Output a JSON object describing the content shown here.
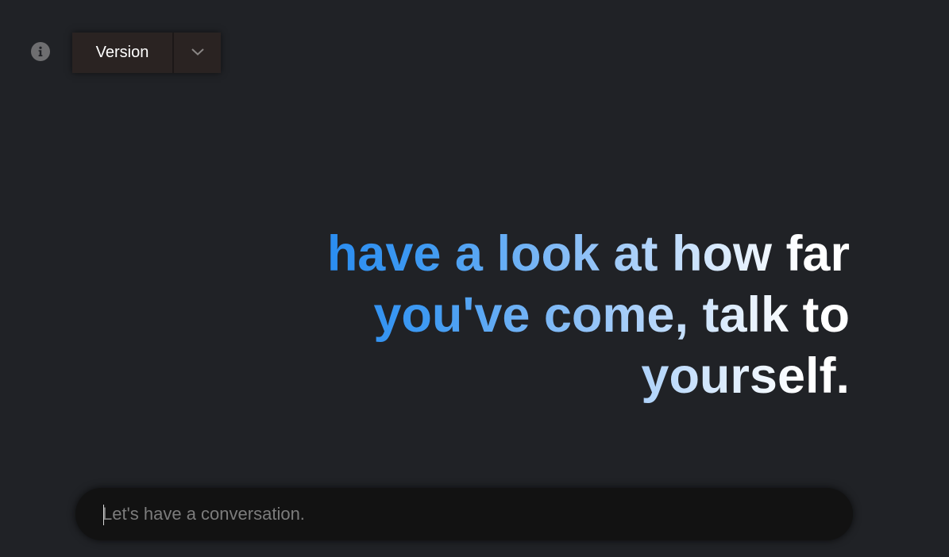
{
  "header": {
    "info_icon": "info-icon",
    "version_label": "Version",
    "dropdown_icon": "chevron-down-icon"
  },
  "hero": {
    "text": "have a look at how far you've come, talk to yourself."
  },
  "chat": {
    "placeholder": "Let's have a conversation.",
    "value": ""
  },
  "colors": {
    "background": "#202226",
    "gradient_start": "#1a82ef",
    "gradient_end": "#ffffff",
    "button_bg": "#2a2322",
    "input_bg": "#121212"
  }
}
